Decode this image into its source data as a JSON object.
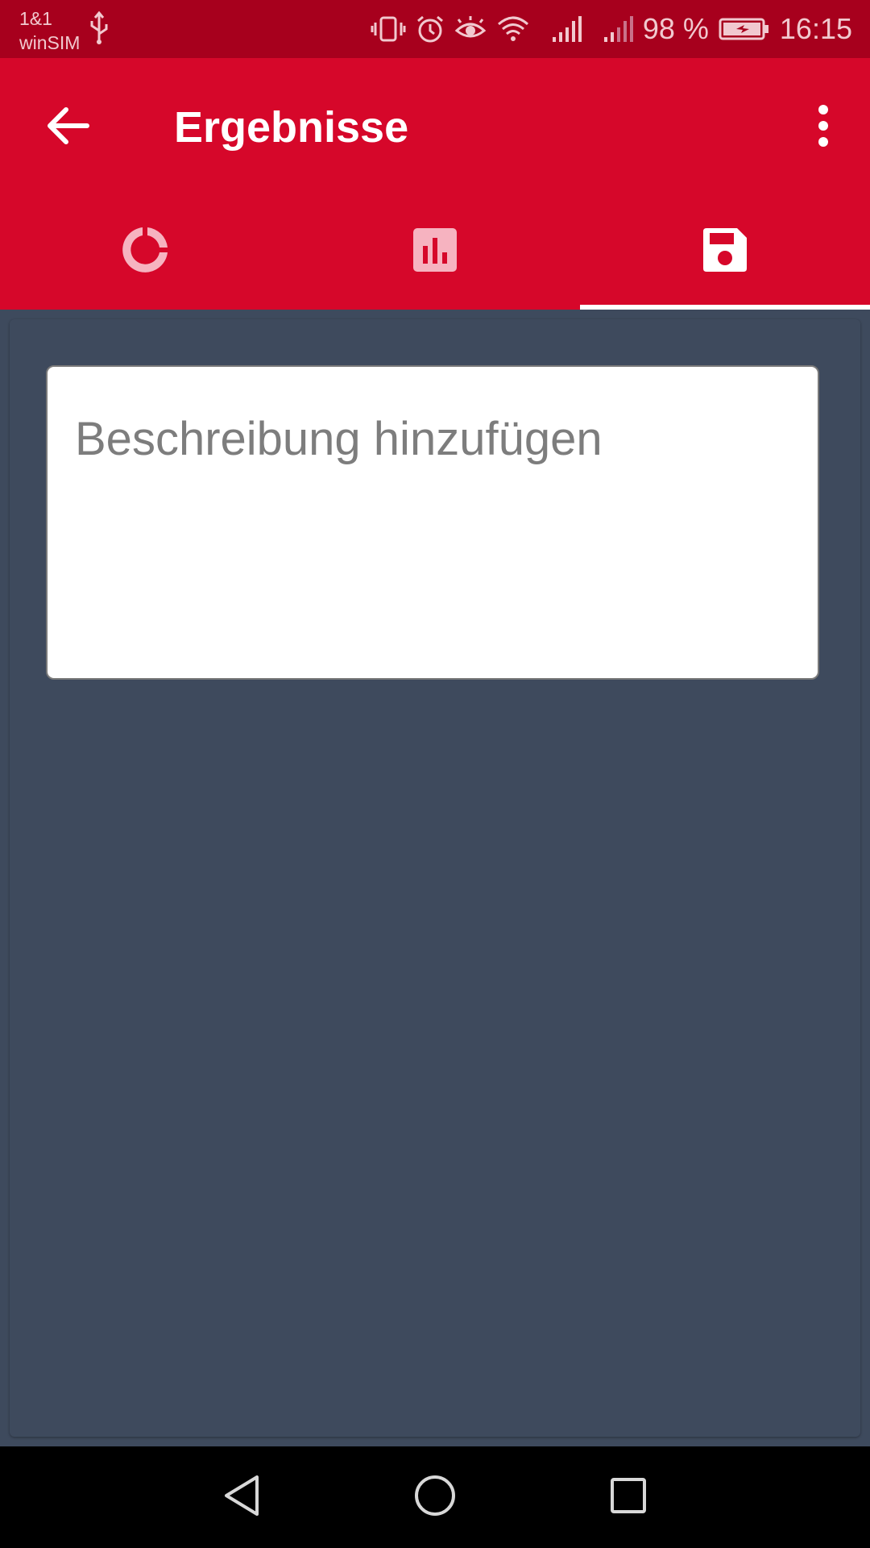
{
  "status_bar": {
    "carrier_line1": "1&1",
    "carrier_line2": "winSIM",
    "battery": "98 %",
    "time": "16:15",
    "icons": [
      "usb-icon",
      "vibrate-icon",
      "alarm-icon",
      "eye-comfort-icon",
      "wifi-icon",
      "signal-icon",
      "signal-icon",
      "battery-charging-icon"
    ]
  },
  "app_bar": {
    "title": "Ergebnisse",
    "back_icon": "arrow-back-icon",
    "more_icon": "more-vert-icon",
    "accent_color": "#d6072a"
  },
  "tabs": [
    {
      "icon": "donut-chart-icon",
      "selected": false
    },
    {
      "icon": "bar-chart-icon",
      "selected": false
    },
    {
      "icon": "save-icon",
      "selected": true
    }
  ],
  "main": {
    "description_placeholder": "Beschreibung hinzufügen",
    "description_value": "",
    "background_color": "#3e4a5d"
  },
  "nav_bar": {
    "icons": [
      "back-triangle-icon",
      "home-circle-icon",
      "recents-square-icon"
    ]
  }
}
